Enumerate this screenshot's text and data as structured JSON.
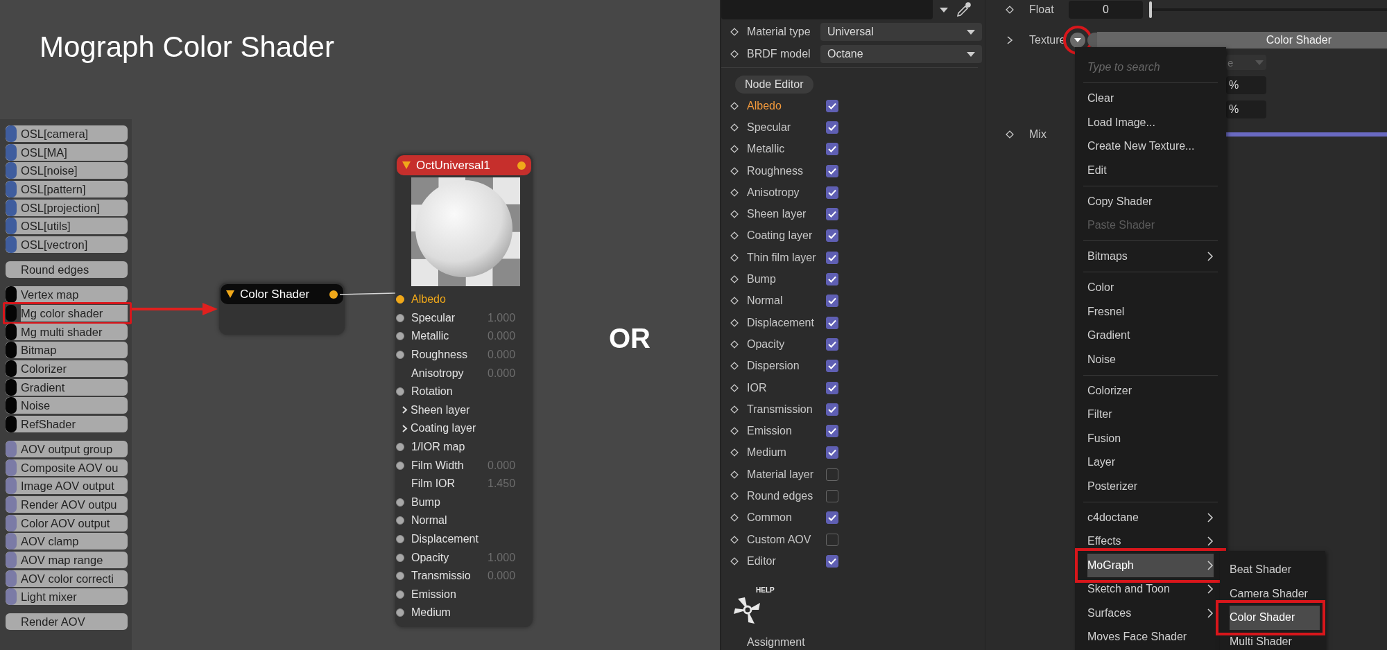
{
  "title": "Mograph Color Shader",
  "node_list": {
    "groups": [
      {
        "items": [
          {
            "label": "OSL[camera]",
            "color": "#3f5d9e",
            "annotated": false
          },
          {
            "label": "OSL[MA]",
            "color": "#3f5d9e",
            "annotated": false
          },
          {
            "label": "OSL[noise]",
            "color": "#3f5d9e",
            "annotated": false
          },
          {
            "label": "OSL[pattern]",
            "color": "#3f5d9e",
            "annotated": false
          },
          {
            "label": "OSL[projection]",
            "color": "#3f5d9e",
            "annotated": false
          },
          {
            "label": "OSL[utils]",
            "color": "#3f5d9e",
            "annotated": false
          },
          {
            "label": "OSL[vectron]",
            "color": "#3f5d9e",
            "annotated": false
          }
        ]
      },
      {
        "items": [
          {
            "label": "Round edges",
            "annotated": false
          }
        ]
      },
      {
        "items": [
          {
            "label": "Vertex map",
            "color": "#050505",
            "annotated": false
          },
          {
            "label": "Mg color shader",
            "color": "#050505",
            "annotated": true
          },
          {
            "label": "Mg multi shader",
            "color": "#050505",
            "annotated": false
          },
          {
            "label": "Bitmap",
            "color": "#050505",
            "annotated": false
          },
          {
            "label": "Colorizer",
            "color": "#050505",
            "annotated": false
          },
          {
            "label": "Gradient",
            "color": "#050505",
            "annotated": false
          },
          {
            "label": "Noise",
            "color": "#050505",
            "annotated": false
          },
          {
            "label": "RefShader",
            "color": "#050505",
            "annotated": false
          }
        ]
      },
      {
        "items": [
          {
            "label": "AOV output group",
            "color": "#7b7ba6",
            "annotated": false
          },
          {
            "label": "Composite AOV ou",
            "color": "#7b7ba6",
            "annotated": false
          },
          {
            "label": "Image AOV output",
            "color": "#7b7ba6",
            "annotated": false
          },
          {
            "label": "Render AOV outpu",
            "color": "#7b7ba6",
            "annotated": false
          },
          {
            "label": "Color AOV output",
            "color": "#7b7ba6",
            "annotated": false
          },
          {
            "label": "AOV clamp",
            "color": "#7b7ba6",
            "annotated": false
          },
          {
            "label": "AOV map range",
            "color": "#7b7ba6",
            "annotated": false
          },
          {
            "label": "AOV color correcti",
            "color": "#7b7ba6",
            "annotated": false
          },
          {
            "label": "Light mixer",
            "color": "#7b7ba6",
            "annotated": false
          }
        ]
      },
      {
        "items": [
          {
            "label": "Render AOV",
            "annotated": false
          }
        ]
      }
    ]
  },
  "nodes": [
    {
      "kind": "shader",
      "title": "Color Shader"
    },
    {
      "kind": "material",
      "title": "OctUniversal1",
      "ports": [
        {
          "kind": "input",
          "label": "Albedo",
          "connected": true
        },
        {
          "kind": "input",
          "label": "Specular",
          "value": "1.000",
          "connected": false
        },
        {
          "kind": "input",
          "label": "Metallic",
          "value": "0.000",
          "connected": false
        },
        {
          "kind": "input",
          "label": "Roughness",
          "value": "0.000",
          "connected": false
        },
        {
          "kind": "parameter",
          "label": "Anisotropy",
          "value": "0.000",
          "connected": false
        },
        {
          "kind": "input",
          "label": "Rotation",
          "connected": false
        },
        {
          "kind": "group",
          "label": "Sheen layer",
          "connected": false
        },
        {
          "kind": "group",
          "label": "Coating layer",
          "connected": false
        },
        {
          "kind": "input",
          "label": "1/IOR map",
          "connected": false
        },
        {
          "kind": "input",
          "label": "Film Width",
          "value": "0.000",
          "connected": false
        },
        {
          "kind": "parameter",
          "label": "Film IOR",
          "value": "1.450",
          "connected": false
        },
        {
          "kind": "input",
          "label": "Bump",
          "connected": false
        },
        {
          "kind": "input",
          "label": "Normal",
          "connected": false
        },
        {
          "kind": "input",
          "label": "Displacement",
          "connected": false
        },
        {
          "kind": "input",
          "label": "Opacity",
          "value": "1.000",
          "connected": false
        },
        {
          "kind": "input",
          "label": "Transmissio",
          "value": "0.000",
          "connected": false
        },
        {
          "kind": "input",
          "label": "Emission",
          "connected": false
        },
        {
          "kind": "input",
          "label": "Medium",
          "connected": false
        }
      ]
    }
  ],
  "separator_label": "OR",
  "material_panel": {
    "material_type": {
      "label": "Material type",
      "value": "Universal"
    },
    "brdf_model": {
      "label": "BRDF model",
      "value": "Octane"
    },
    "node_editor_button": "Node Editor",
    "channels": [
      {
        "label": "Albedo",
        "checked": true,
        "active": true
      },
      {
        "label": "Specular",
        "checked": true,
        "active": false
      },
      {
        "label": "Metallic",
        "checked": true,
        "active": false
      },
      {
        "label": "Roughness",
        "checked": true,
        "active": false
      },
      {
        "label": "Anisotropy",
        "checked": true,
        "active": false
      },
      {
        "label": "Sheen layer",
        "checked": true,
        "active": false
      },
      {
        "label": "Coating layer",
        "checked": true,
        "active": false
      },
      {
        "label": "Thin film layer",
        "checked": true,
        "active": false
      },
      {
        "label": "Bump",
        "checked": true,
        "active": false
      },
      {
        "label": "Normal",
        "checked": true,
        "active": false
      },
      {
        "label": "Displacement",
        "checked": true,
        "active": false
      },
      {
        "label": "Opacity",
        "checked": true,
        "active": false
      },
      {
        "label": "Dispersion",
        "checked": true,
        "active": false
      },
      {
        "label": "IOR",
        "checked": true,
        "active": false
      },
      {
        "label": "Transmission",
        "checked": true,
        "active": false
      },
      {
        "label": "Emission",
        "checked": true,
        "active": false
      },
      {
        "label": "Medium",
        "checked": true,
        "active": false
      },
      {
        "label": "Material layer",
        "checked": false,
        "active": false
      },
      {
        "label": "Round edges",
        "checked": false,
        "active": false
      },
      {
        "label": "Common",
        "checked": true,
        "active": false
      },
      {
        "label": "Custom AOV",
        "checked": false,
        "active": false
      },
      {
        "label": "Editor",
        "checked": true,
        "active": false
      }
    ],
    "help_label": "HELP",
    "assignment_label": "Assignment"
  },
  "shader_panel": {
    "float": {
      "label": "Float",
      "value": "0",
      "level": 0
    },
    "texture": {
      "label": "Texture",
      "value": "Color Shader",
      "annotated": true
    },
    "covered_dropdown": {
      "value": "e"
    },
    "percent_fields": [
      "%",
      "%"
    ],
    "mix": {
      "label": "Mix"
    },
    "menu": {
      "search_placeholder": "Type to search",
      "items": [
        {
          "kind": "item",
          "label": "Clear",
          "submenu": false,
          "disabled": false,
          "selected": false,
          "annotated": false
        },
        {
          "kind": "item",
          "label": "Load Image...",
          "submenu": false,
          "disabled": false,
          "selected": false,
          "annotated": false
        },
        {
          "kind": "item",
          "label": "Create New Texture...",
          "submenu": false,
          "disabled": false,
          "selected": false,
          "annotated": false
        },
        {
          "kind": "item",
          "label": "Edit",
          "submenu": false,
          "disabled": false,
          "selected": false,
          "annotated": false
        },
        {
          "kind": "separator"
        },
        {
          "kind": "item",
          "label": "Copy Shader",
          "submenu": false,
          "disabled": false,
          "selected": false,
          "annotated": false
        },
        {
          "kind": "item",
          "label": "Paste Shader",
          "submenu": false,
          "disabled": true,
          "selected": false,
          "annotated": false
        },
        {
          "kind": "separator"
        },
        {
          "kind": "item",
          "label": "Bitmaps",
          "submenu": true,
          "disabled": false,
          "selected": false,
          "annotated": false
        },
        {
          "kind": "separator"
        },
        {
          "kind": "item",
          "label": "Color",
          "submenu": false,
          "disabled": false,
          "selected": false,
          "annotated": false
        },
        {
          "kind": "item",
          "label": "Fresnel",
          "submenu": false,
          "disabled": false,
          "selected": false,
          "annotated": false
        },
        {
          "kind": "item",
          "label": "Gradient",
          "submenu": false,
          "disabled": false,
          "selected": false,
          "annotated": false
        },
        {
          "kind": "item",
          "label": "Noise",
          "submenu": false,
          "disabled": false,
          "selected": false,
          "annotated": false
        },
        {
          "kind": "separator"
        },
        {
          "kind": "item",
          "label": "Colorizer",
          "submenu": false,
          "disabled": false,
          "selected": false,
          "annotated": false
        },
        {
          "kind": "item",
          "label": "Filter",
          "submenu": false,
          "disabled": false,
          "selected": false,
          "annotated": false
        },
        {
          "kind": "item",
          "label": "Fusion",
          "submenu": false,
          "disabled": false,
          "selected": false,
          "annotated": false
        },
        {
          "kind": "item",
          "label": "Layer",
          "submenu": false,
          "disabled": false,
          "selected": false,
          "annotated": false
        },
        {
          "kind": "item",
          "label": "Posterizer",
          "submenu": false,
          "disabled": false,
          "selected": false,
          "annotated": false
        },
        {
          "kind": "separator"
        },
        {
          "kind": "item",
          "label": "c4doctane",
          "submenu": true,
          "disabled": false,
          "selected": false,
          "annotated": false
        },
        {
          "kind": "item",
          "label": "Effects",
          "submenu": true,
          "disabled": false,
          "selected": false,
          "annotated": false
        },
        {
          "kind": "item",
          "label": "MoGraph",
          "submenu": true,
          "disabled": false,
          "selected": true,
          "annotated": true
        },
        {
          "kind": "item",
          "label": "Sketch and Toon",
          "submenu": true,
          "disabled": false,
          "selected": false,
          "annotated": false
        },
        {
          "kind": "item",
          "label": "Surfaces",
          "submenu": true,
          "disabled": false,
          "selected": false,
          "annotated": false
        },
        {
          "kind": "item",
          "label": "Moves Face Shader",
          "submenu": false,
          "disabled": false,
          "selected": false,
          "annotated": false
        }
      ]
    },
    "submenu": {
      "items": [
        {
          "label": "Beat Shader",
          "selected": false,
          "annotated": false
        },
        {
          "label": "Camera Shader",
          "selected": false,
          "annotated": false
        },
        {
          "label": "Color Shader",
          "selected": true,
          "annotated": true
        },
        {
          "label": "Multi Shader",
          "selected": false,
          "annotated": false
        }
      ]
    }
  }
}
